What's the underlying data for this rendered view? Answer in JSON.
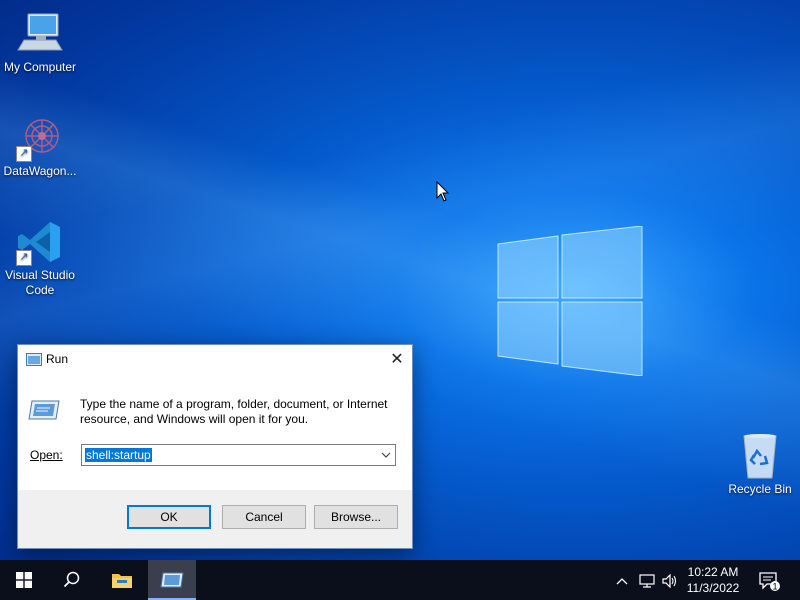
{
  "desktop": {
    "icons": [
      {
        "label": "My Computer",
        "icon": "computer-icon"
      },
      {
        "label": "DataWagon...",
        "icon": "datawagon-icon"
      },
      {
        "label": "Visual Studio Code",
        "icon": "vscode-icon"
      },
      {
        "label": "Recycle Bin",
        "icon": "recycle-bin-icon"
      }
    ]
  },
  "run_dialog": {
    "title": "Run",
    "description": "Type the name of a program, folder, document, or Internet resource, and Windows will open it for you.",
    "open_label": "Open:",
    "input_value": "shell:startup",
    "ok_label": "OK",
    "cancel_label": "Cancel",
    "browse_label": "Browse...",
    "close_symbol": "✕"
  },
  "taskbar": {
    "time": "10:22 AM",
    "date": "11/3/2022",
    "notification_count": "1",
    "items": [
      "start-icon",
      "search-icon",
      "file-explorer-icon",
      "run-icon"
    ]
  },
  "colors": {
    "accent": "#0078d7",
    "taskbar": "#0b0f1c"
  }
}
